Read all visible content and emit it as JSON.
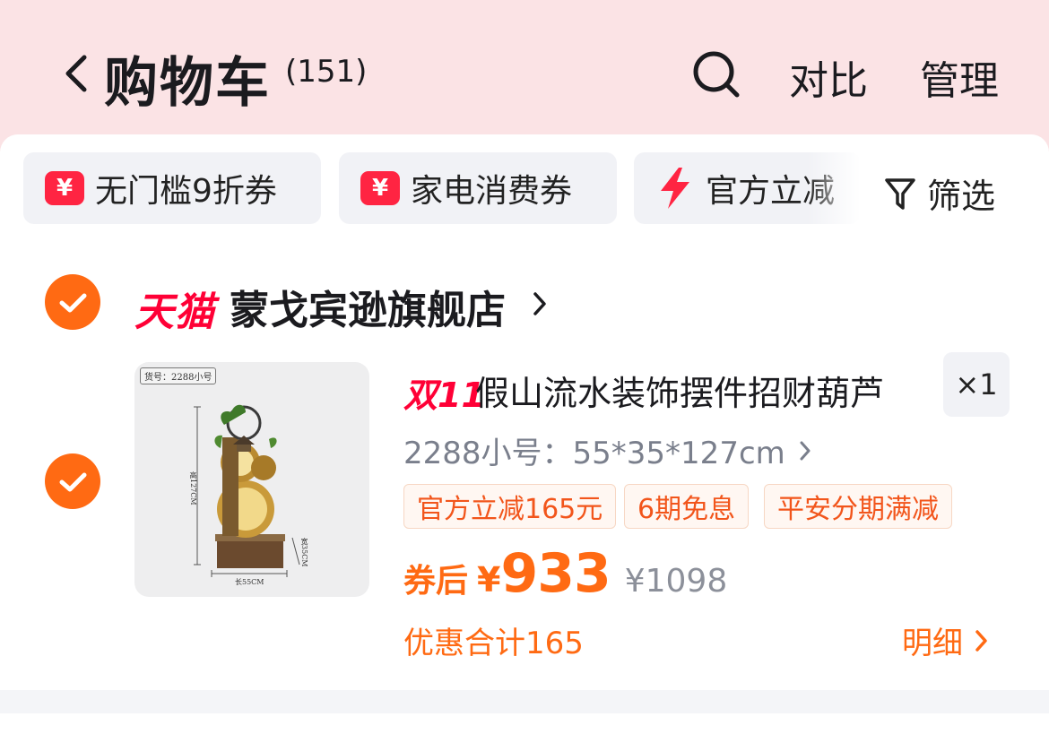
{
  "header": {
    "title": "购物车",
    "count": "(151)",
    "compare_label": "对比",
    "manage_label": "管理"
  },
  "chips": [
    {
      "icon": "yen-coupon-icon",
      "label": "无门槛9折券"
    },
    {
      "icon": "yen-coupon-icon",
      "label": "家电消费券"
    },
    {
      "icon": "lightning-icon",
      "label": "官方立减"
    }
  ],
  "coupon_badge_symbol": "¥",
  "filter_label": "筛选",
  "store": {
    "platform": "天猫",
    "name": "蒙戈宾逊旗舰店"
  },
  "product": {
    "image_tag": "货号：2288小号",
    "image_dim_height": "高127CM",
    "image_dim_depth": "宽35CM",
    "image_dim_width": "长55CM",
    "event_badge": "双11",
    "title": "假山流水装饰摆件招财葫芦",
    "quantity": "×1",
    "spec": "2288小号：55*35*127cm",
    "promos": [
      "官方立减165元",
      "6期免息",
      "平安分期满减"
    ],
    "price_prefix": "券后",
    "currency": "¥",
    "price": "933",
    "original_price": "¥1098",
    "discount_total": "优惠合计165",
    "detail_label": "明细"
  },
  "colors": {
    "accent": "#ff6a13",
    "tmall_red": "#ff0036",
    "header_bg": "#fbe3e5"
  }
}
